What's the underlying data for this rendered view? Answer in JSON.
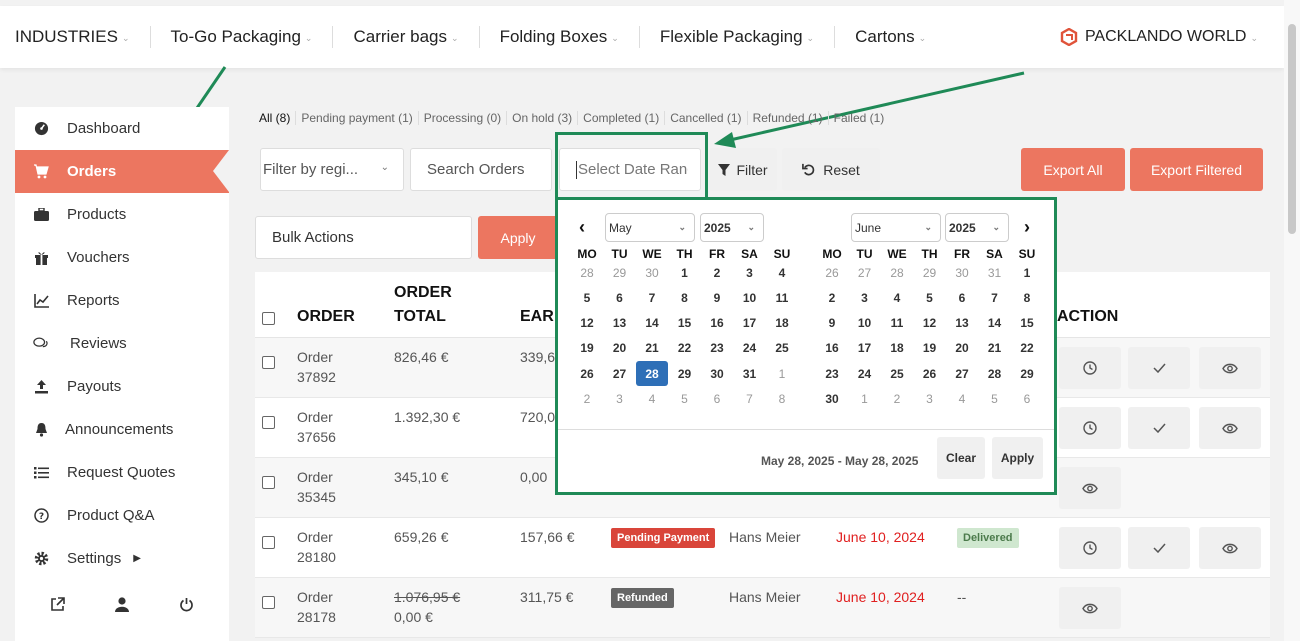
{
  "topnav": {
    "items": [
      "INDUSTRIES",
      "To-Go Packaging",
      "Carrier bags",
      "Folding Boxes",
      "Flexible Packaging",
      "Cartons"
    ],
    "brand": "PACKLANDO WORLD",
    "accent": "#ec7660"
  },
  "sidebar": {
    "items": [
      {
        "label": "Dashboard",
        "icon": "dashboard-icon"
      },
      {
        "label": "Orders",
        "icon": "cart-icon",
        "active": true
      },
      {
        "label": "Products",
        "icon": "briefcase-icon"
      },
      {
        "label": "Vouchers",
        "icon": "gift-icon"
      },
      {
        "label": "Reports",
        "icon": "chart-icon"
      },
      {
        "label": "Reviews",
        "icon": "comments-icon"
      },
      {
        "label": "Payouts",
        "icon": "upload-icon"
      },
      {
        "label": "Announcements",
        "icon": "bell-icon"
      },
      {
        "label": "Request Quotes",
        "icon": "list-icon"
      },
      {
        "label": "Product Q&A",
        "icon": "question-icon"
      },
      {
        "label": "Settings",
        "icon": "gear-icon"
      }
    ]
  },
  "tabs": [
    "All (8)",
    "Pending payment (1)",
    "Processing (0)",
    "On hold (3)",
    "Completed (1)",
    "Cancelled (1)",
    "Refunded (1)",
    "Failed (1)"
  ],
  "filters": {
    "region_placeholder": "Filter by regi...",
    "search_placeholder": "Search Orders",
    "date_placeholder": "Select Date Rang",
    "filter_label": "Filter",
    "reset_label": "Reset",
    "export_all": "Export All",
    "export_filtered": "Export Filtered",
    "bulk_actions": "Bulk Actions",
    "apply": "Apply"
  },
  "table": {
    "headers": {
      "order": "ORDER",
      "total_1": "ORDER",
      "total_2": "TOTAL",
      "earnings": "EAR",
      "action": "ACTION"
    },
    "rows": [
      {
        "order_1": "Order",
        "order_2": "37892",
        "total": "826,46 €",
        "earnings": "339,6"
      },
      {
        "order_1": "Order",
        "order_2": "37656",
        "total": "1.392,30 €",
        "earnings": "720,0"
      },
      {
        "order_1": "Order",
        "order_2": "35345",
        "total": "345,10 €",
        "earnings": "0,00"
      },
      {
        "order_1": "Order",
        "order_2": "28180",
        "total": "659,26 €",
        "earnings": "157,66 €",
        "status": "Pending Payment",
        "customer": "Hans Meier",
        "date": "June 10, 2024",
        "shipping": "Delivered"
      },
      {
        "order_1": "Order",
        "order_2": "28178",
        "total": "1.076,95 €",
        "total_new": "0,00 €",
        "earnings": "311,75 €",
        "status": "Refunded",
        "customer": "Hans Meier",
        "date": "June 10, 2024",
        "shipping": "--"
      }
    ]
  },
  "calendar": {
    "left": {
      "month": "May",
      "year": "2025"
    },
    "right": {
      "month": "June",
      "year": "2025"
    },
    "dow": [
      "MO",
      "TU",
      "WE",
      "TH",
      "FR",
      "SA",
      "SU"
    ],
    "left_days": [
      [
        "28",
        "29",
        "30",
        "1",
        "2",
        "3",
        "4"
      ],
      [
        "5",
        "6",
        "7",
        "8",
        "9",
        "10",
        "11"
      ],
      [
        "12",
        "13",
        "14",
        "15",
        "16",
        "17",
        "18"
      ],
      [
        "19",
        "20",
        "21",
        "22",
        "23",
        "24",
        "25"
      ],
      [
        "26",
        "27",
        "28",
        "29",
        "30",
        "31",
        "1"
      ],
      [
        "2",
        "3",
        "4",
        "5",
        "6",
        "7",
        "8"
      ]
    ],
    "right_days": [
      [
        "26",
        "27",
        "28",
        "29",
        "30",
        "31",
        "1"
      ],
      [
        "2",
        "3",
        "4",
        "5",
        "6",
        "7",
        "8"
      ],
      [
        "9",
        "10",
        "11",
        "12",
        "13",
        "14",
        "15"
      ],
      [
        "16",
        "17",
        "18",
        "19",
        "20",
        "21",
        "22"
      ],
      [
        "23",
        "24",
        "25",
        "26",
        "27",
        "28",
        "29"
      ],
      [
        "30",
        "1",
        "2",
        "3",
        "4",
        "5",
        "6"
      ]
    ],
    "range_text": "May 28, 2025 - May 28, 2025",
    "clear": "Clear",
    "apply": "Apply",
    "highlight_color": "#1f8a57"
  }
}
